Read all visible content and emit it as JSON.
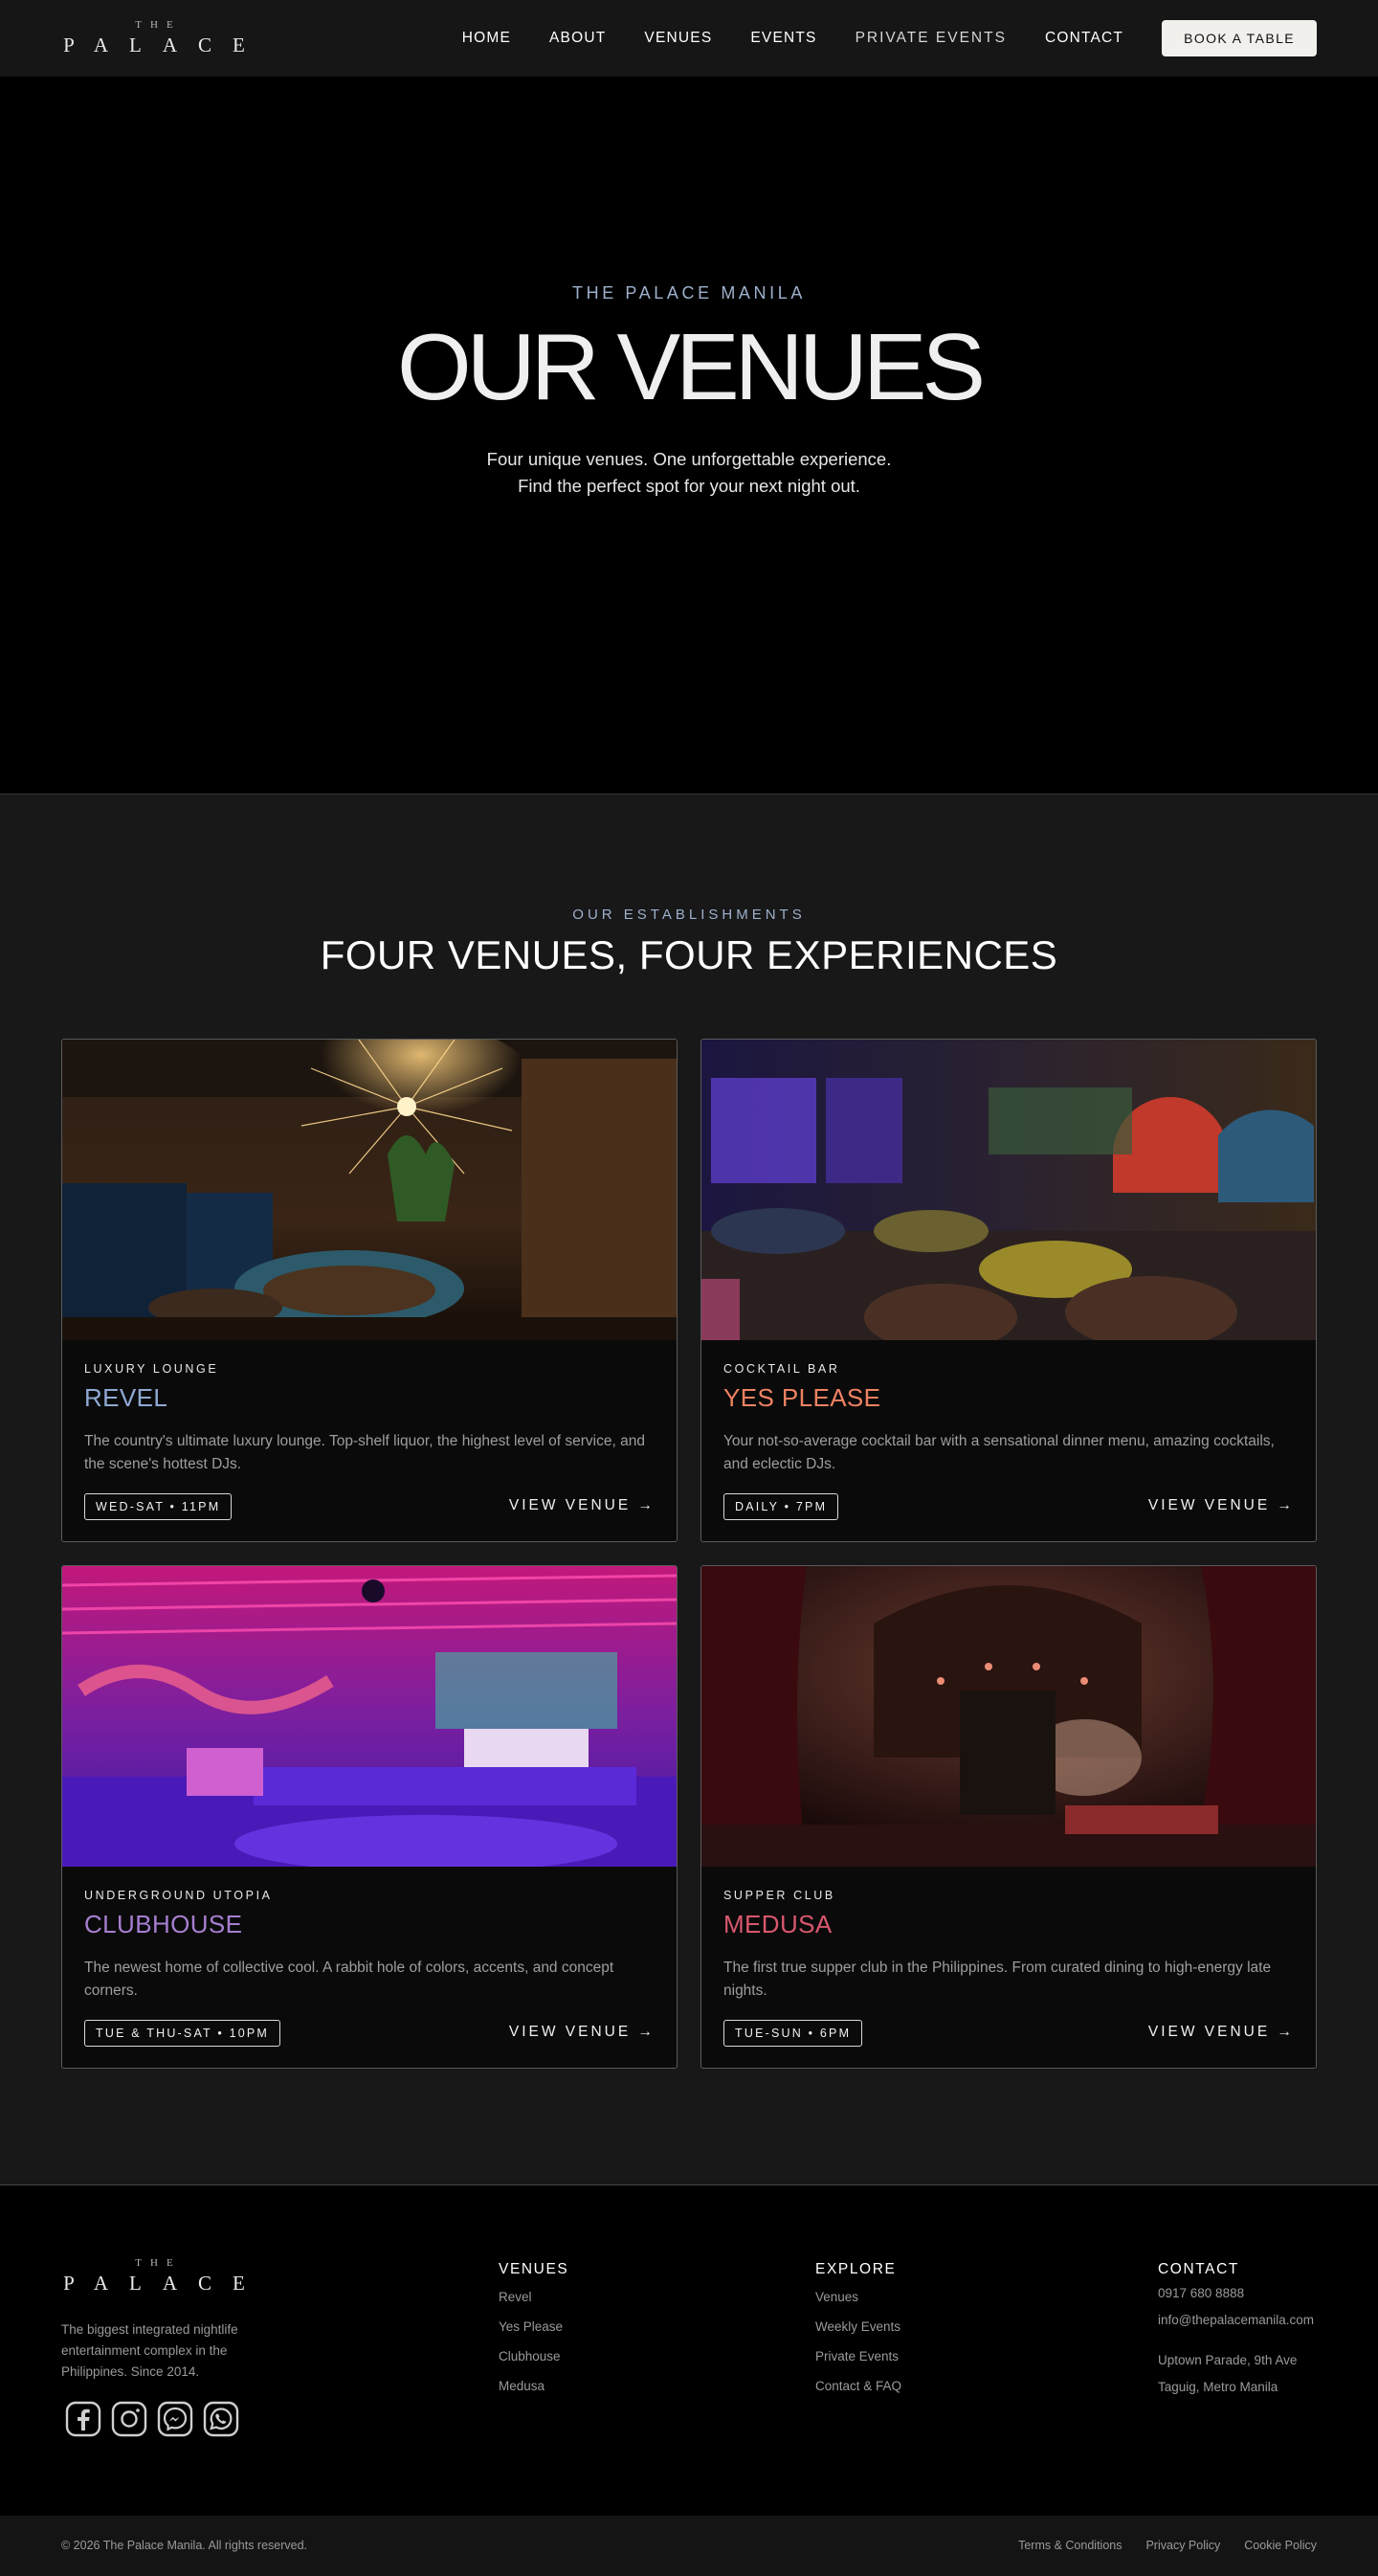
{
  "brand": {
    "logo_the": "THE",
    "logo_palace": "PALACE"
  },
  "nav": {
    "links": [
      "HOME",
      "ABOUT",
      "VENUES",
      "EVENTS",
      "PRIVATE EVENTS",
      "CONTACT"
    ],
    "cta": "BOOK A TABLE"
  },
  "hero": {
    "eyebrow": "THE PALACE MANILA",
    "title": "OUR VENUES",
    "subtitle_line1": "Four unique venues. One unforgettable experience.",
    "subtitle_line2": "Find the perfect spot for your next night out."
  },
  "section": {
    "eyebrow": "OUR ESTABLISHMENTS",
    "title": "FOUR VENUES, FOUR EXPERIENCES"
  },
  "venues": [
    {
      "category": "LUXURY LOUNGE",
      "name": "REVEL",
      "name_color": "#8fa9d4",
      "description": "The country's ultimate luxury lounge. Top-shelf liquor, the highest level of service, and the scene's hottest DJs.",
      "hours": "WED-SAT • 11PM",
      "link": "VIEW VENUE →"
    },
    {
      "category": "COCKTAIL BAR",
      "name": "YES PLEASE",
      "name_color": "#ee8262",
      "description": "Your not-so-average cocktail bar with a sensational dinner menu, amazing cocktails, and eclectic DJs.",
      "hours": "DAILY • 7PM",
      "link": "VIEW VENUE →"
    },
    {
      "category": "UNDERGROUND UTOPIA",
      "name": "CLUBHOUSE",
      "name_color": "#a77ed0",
      "description": "The newest home of collective cool. A rabbit hole of colors, accents, and concept corners.",
      "hours": "TUE & THU-SAT • 10PM",
      "link": "VIEW VENUE →"
    },
    {
      "category": "SUPPER CLUB",
      "name": "MEDUSA",
      "name_color": "#d9576e",
      "description": "The first true supper club in the Philippines. From curated dining to high-energy late nights.",
      "hours": "TUE-SUN • 6PM",
      "link": "VIEW VENUE →"
    }
  ],
  "footer": {
    "tagline": "The biggest integrated nightlife entertainment complex in the Philippines. Since 2014.",
    "social_icons": [
      "facebook-icon",
      "instagram-icon",
      "messenger-icon",
      "whatsapp-icon"
    ],
    "venues_heading": "VENUES",
    "venues_links": [
      "Revel",
      "Yes Please",
      "Clubhouse",
      "Medusa"
    ],
    "explore_heading": "EXPLORE",
    "explore_links": [
      "Venues",
      "Weekly Events",
      "Private Events",
      "Contact & FAQ"
    ],
    "contact_heading": "CONTACT",
    "phone": "0917 680 8888",
    "email": "info@thepalacemanila.com",
    "address_line1": "Uptown Parade, 9th Ave",
    "address_line2": "Taguig, Metro Manila",
    "copyright": "© 2026 The Palace Manila. All rights reserved.",
    "legal_links": [
      "Terms & Conditions",
      "Privacy Policy",
      "Cookie Policy"
    ]
  }
}
